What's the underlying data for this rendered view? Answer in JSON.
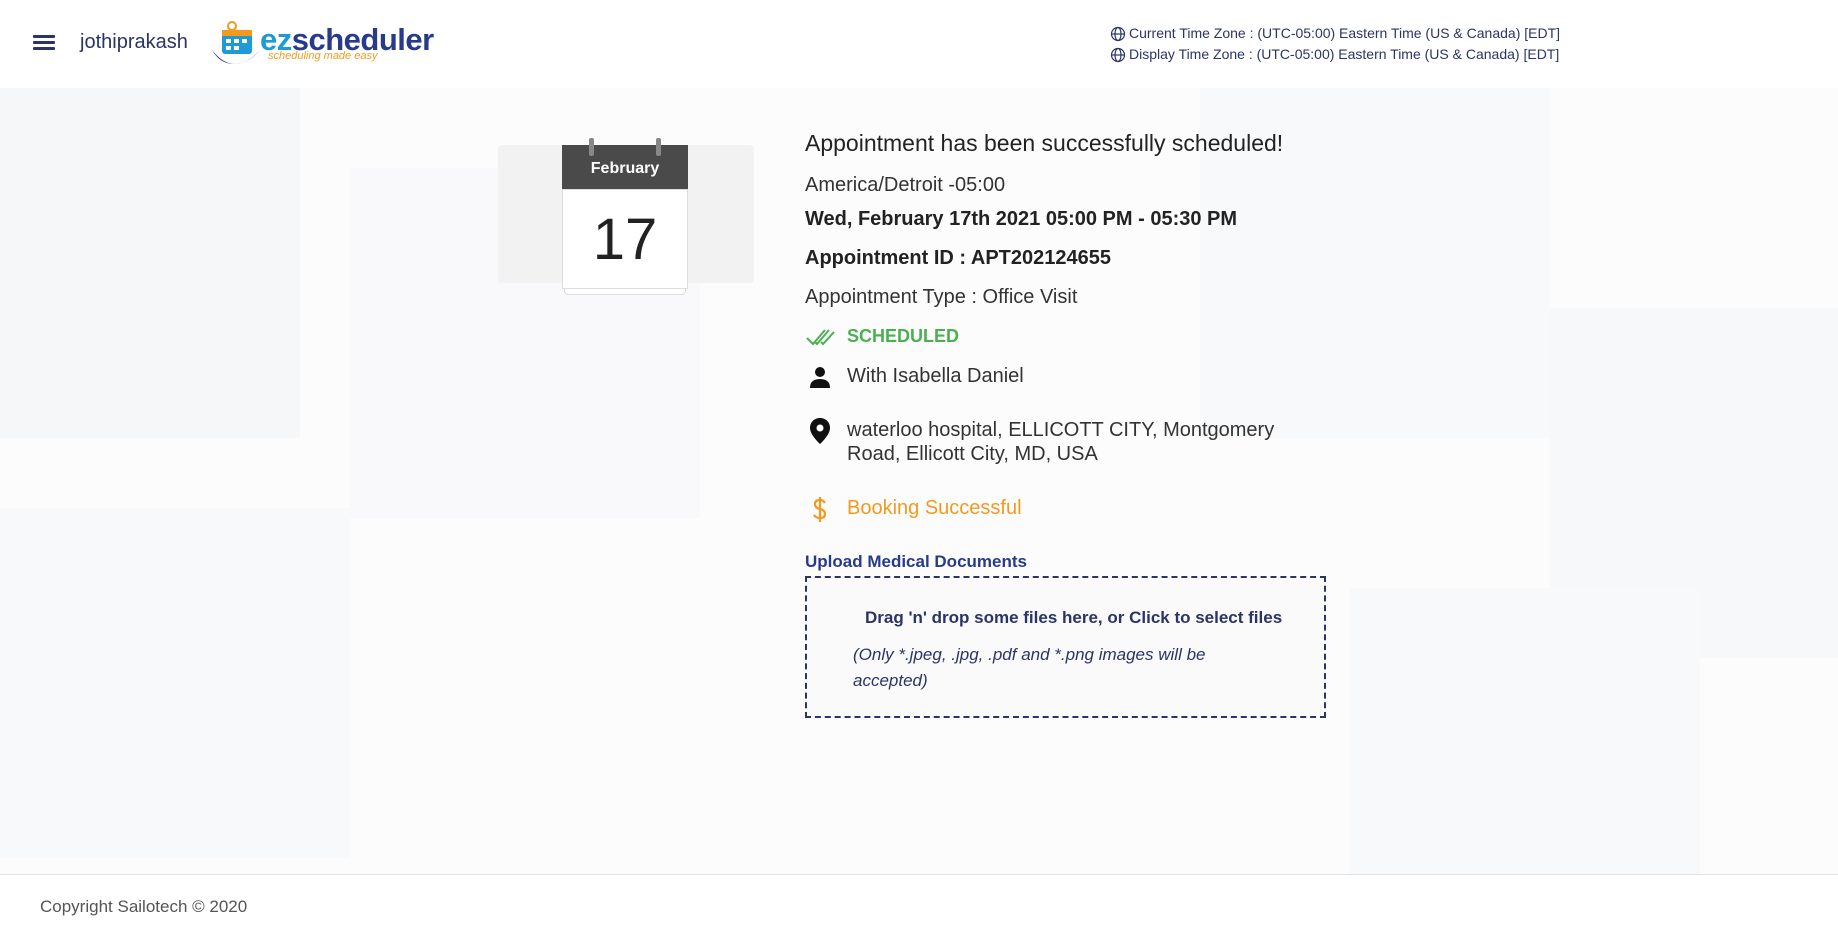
{
  "header": {
    "username": "jothiprakash",
    "logo": {
      "ez": "ez",
      "scheduler": "scheduler",
      "tagline": "scheduling made easy"
    },
    "current_tz": "Current Time Zone : (UTC-05:00) Eastern Time (US & Canada) [EDT]",
    "display_tz": "Display Time Zone : (UTC-05:00) Eastern Time (US & Canada) [EDT]"
  },
  "calendar": {
    "month": "February",
    "day": "17"
  },
  "appointment": {
    "title": "Appointment has been successfully scheduled!",
    "timezone": "America/Detroit -05:00",
    "datetime": "Wed, February 17th 2021 05:00 PM - 05:30 PM",
    "id": "Appointment ID : APT202124655",
    "type": "Appointment Type : Office Visit",
    "status": "SCHEDULED",
    "with": "With Isabella Daniel",
    "location": "waterloo hospital, ELLICOTT CITY, Montgomery Road, Ellicott City, MD, USA",
    "payment": "Booking Successful"
  },
  "upload": {
    "link": "Upload Medical Documents",
    "dropzone_text": "Drag 'n' drop some files here, or Click to select files",
    "dropzone_note": "(Only *.jpeg, .jpg, .pdf and *.png images will be accepted)"
  },
  "footer": {
    "copyright": "Copyright Sailotech © 2020"
  },
  "colors": {
    "primary": "#2b3466",
    "success": "#4caf50",
    "warning": "#f39a1e",
    "logo_blue": "#1e9bd7"
  },
  "icons": {
    "menu": "menu-icon",
    "globe": "globe-icon",
    "status": "double-check-icon",
    "person": "person-icon",
    "location": "map-pin-icon",
    "payment": "dollar-icon"
  }
}
